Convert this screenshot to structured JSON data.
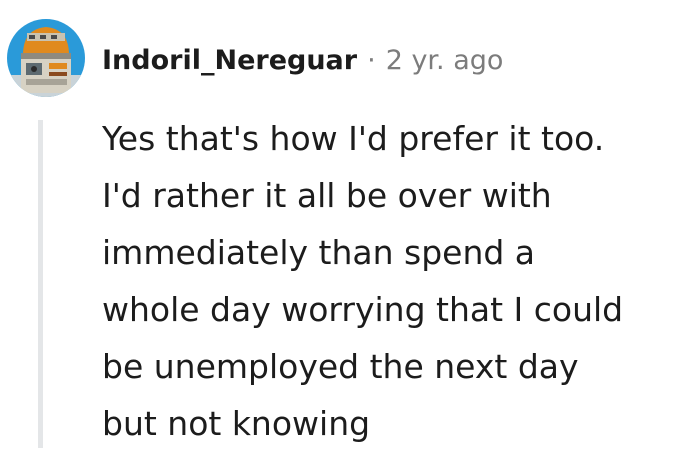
{
  "comment": {
    "author": "Indoril_Nereguar",
    "separator": "·",
    "timestamp": "2 yr. ago",
    "avatar_icon": "robot-avatar-icon",
    "body_lines": [
      "Yes that's how I'd prefer it too.",
      "I'd rather it all be over with",
      "immediately than spend a",
      "whole day worrying that I could",
      "be unemployed the next day",
      "but not knowing"
    ]
  },
  "colors": {
    "username": "#1c1c1c",
    "meta": "#7c7c7c",
    "body": "#1c1c1c",
    "thread_line": "#e4e6e8",
    "avatar_bg": "#2a9ad9",
    "avatar_accent": "#e08a1e"
  }
}
